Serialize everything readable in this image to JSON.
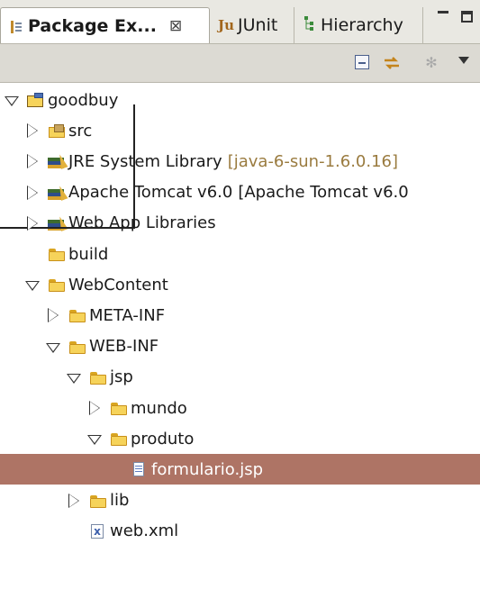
{
  "tabs": [
    {
      "label": "Package Ex...",
      "icon": "package-explorer-icon",
      "close": "⊠"
    },
    {
      "label": "JUnit",
      "icon": "junit-icon",
      "icon_text": "Ju"
    },
    {
      "label": "Hierarchy",
      "icon": "hierarchy-icon"
    }
  ],
  "toolbar": {
    "buttons": [
      "collapse-all-icon",
      "link-with-editor-icon",
      "gear-icon",
      "view-menu-icon"
    ]
  },
  "tree": [
    {
      "label": "goodbuy",
      "twisty": "expanded",
      "icon": "project-icon",
      "level": 0
    },
    {
      "label": "src",
      "twisty": "collapsed",
      "icon": "srcfolder-icon",
      "level": 1
    },
    {
      "label": "JRE System Library",
      "decoration": "[java-6-sun-1.6.0.16]",
      "twisty": "collapsed",
      "icon": "library-icon",
      "level": 1
    },
    {
      "label": "Apache Tomcat v6.0",
      "decoration": "[Apache Tomcat v6.0",
      "twisty": "collapsed",
      "icon": "library-icon",
      "level": 1,
      "decoration_color": "#1a1a1a"
    },
    {
      "label": "Web App Libraries",
      "twisty": "collapsed",
      "icon": "library-icon",
      "level": 1
    },
    {
      "label": "build",
      "twisty": "none",
      "icon": "folder-icon",
      "level": 1
    },
    {
      "label": "WebContent",
      "twisty": "expanded",
      "icon": "folder-icon",
      "level": 1
    },
    {
      "label": "META-INF",
      "twisty": "collapsed",
      "icon": "folder-icon",
      "level": 2
    },
    {
      "label": "WEB-INF",
      "twisty": "expanded",
      "icon": "folder-icon",
      "level": 2
    },
    {
      "label": "jsp",
      "twisty": "expanded",
      "icon": "folder-icon",
      "level": 3
    },
    {
      "label": "mundo",
      "twisty": "collapsed",
      "icon": "folder-icon",
      "level": 4
    },
    {
      "label": "produto",
      "twisty": "expanded",
      "icon": "folder-icon",
      "level": 4
    },
    {
      "label": "formulario.jsp",
      "twisty": "none",
      "icon": "jsp-file-icon",
      "level": 5,
      "selected": true
    },
    {
      "label": "lib",
      "twisty": "collapsed",
      "icon": "folder-icon",
      "level": 3
    },
    {
      "label": "web.xml",
      "twisty": "none",
      "icon": "xml-file-icon",
      "level": 3
    }
  ],
  "colors": {
    "selection": "#ae7465",
    "decoration": "#9a7b3f"
  }
}
